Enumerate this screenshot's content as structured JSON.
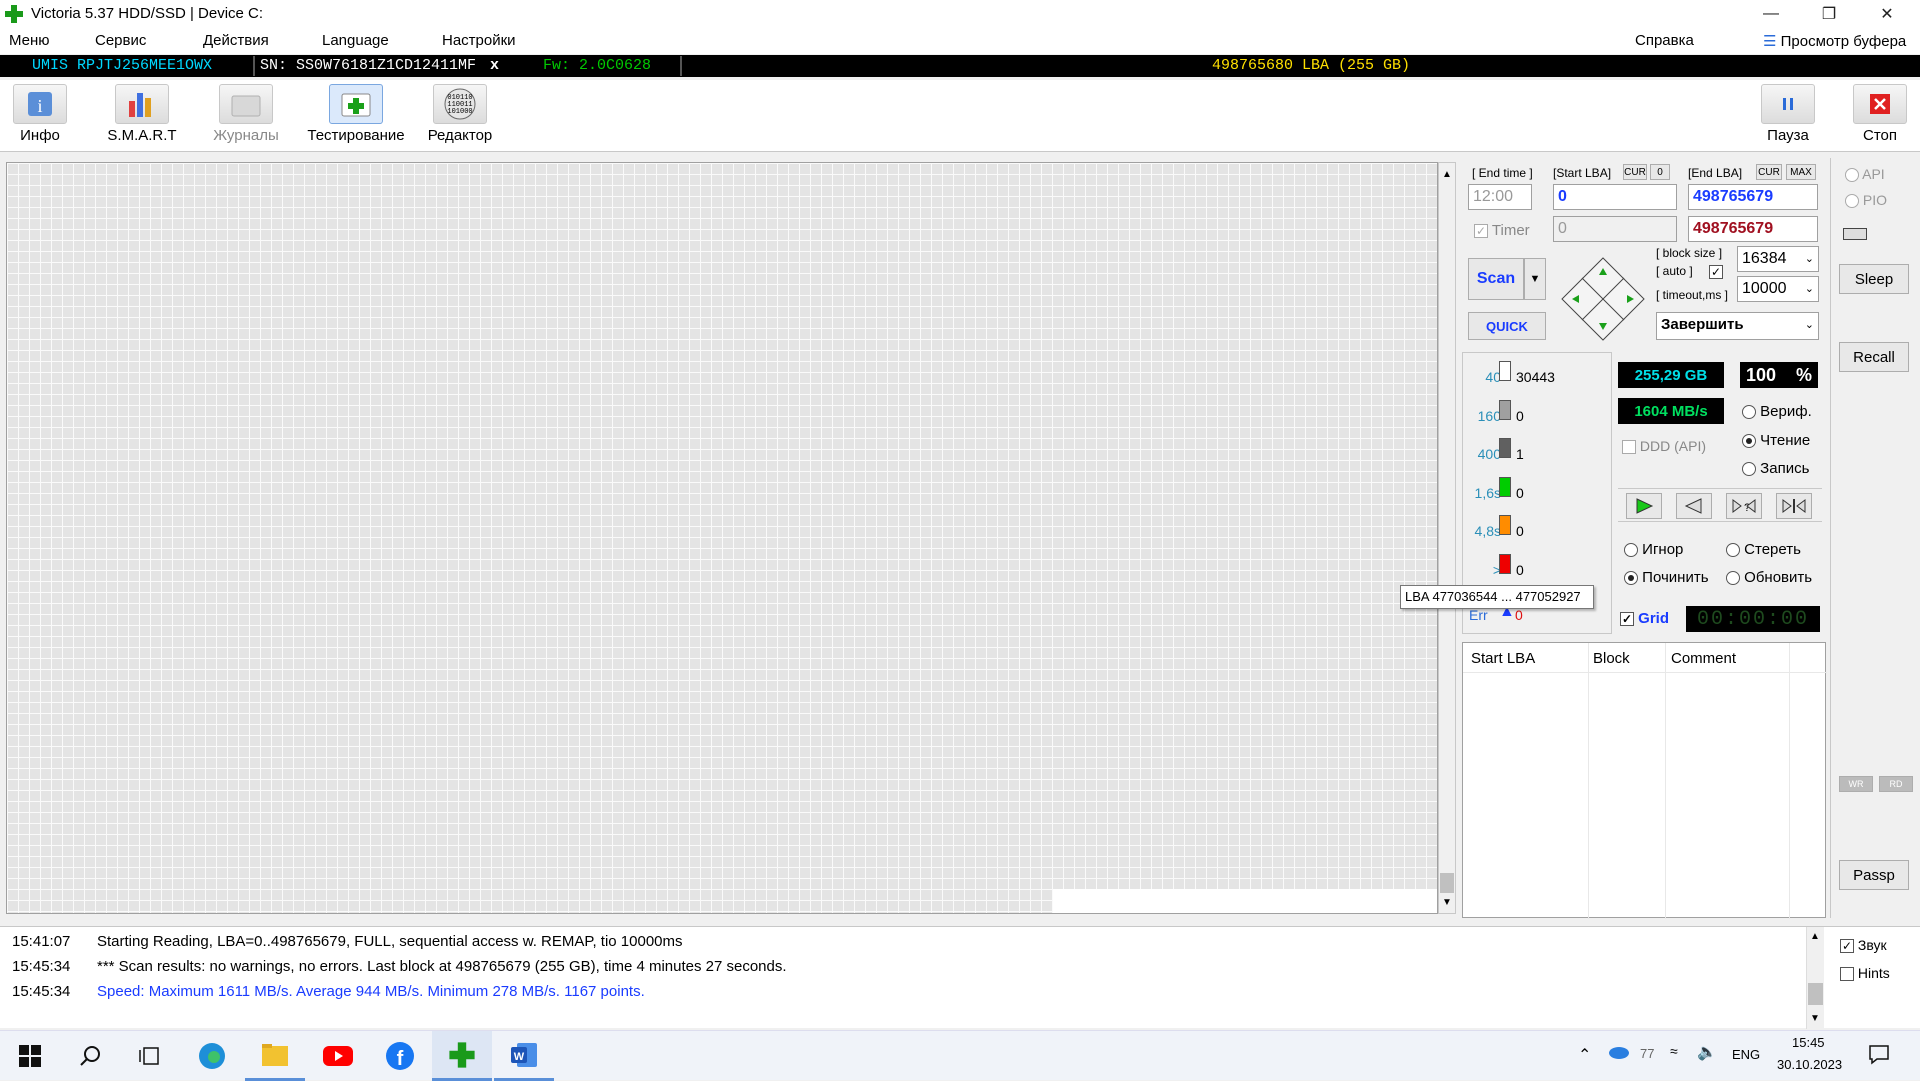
{
  "window": {
    "title": "Victoria 5.37 HDD/SSD | Device C:"
  },
  "menu": {
    "items": [
      "Меню",
      "Сервис",
      "Действия",
      "Language",
      "Настройки"
    ],
    "help": "Справка",
    "view_buffer": "Просмотр буфера"
  },
  "device": {
    "model": "UMIS RPJTJ256MEE1OWX",
    "serial": "SN: SS0W76181Z1CD12411MF",
    "close": "x",
    "firmware": "Fw: 2.0C0628",
    "capacity": "498765680 LBA (255 GB)"
  },
  "toolbar": {
    "tools": [
      "Инфо",
      "S.M.A.R.T",
      "Журналы",
      "Тестирование",
      "Редактор"
    ],
    "pause": "Пауза",
    "stop": "Стоп"
  },
  "scan": {
    "end_time_label": "[ End time ]",
    "end_time": "12:00",
    "timer_label": "Timer",
    "start_lba_label": "[Start LBA]",
    "cur": "CUR",
    "zero": "0",
    "start_lba": "0",
    "start_lba2": "0",
    "end_lba_label": "[End LBA]",
    "max": "MAX",
    "end_lba": "498765679",
    "end_lba2": "498765679",
    "scan_btn": "Scan",
    "quick_btn": "QUICK",
    "block_size_label": "[ block size ]",
    "auto_label": "[ auto ]",
    "block_size": "16384",
    "timeout_label": "[ timeout,ms ]",
    "timeout": "10000",
    "finish": "Завершить"
  },
  "stats": {
    "rows": [
      {
        "label": "40",
        "count": "30443",
        "color": "#ffffff"
      },
      {
        "label": "160",
        "count": "0",
        "color": "#a0a0a0"
      },
      {
        "label": "400",
        "count": "1",
        "color": "#606060"
      },
      {
        "label": "1,6s",
        "count": "0",
        "color": "#00cc00"
      },
      {
        "label": "4,8s",
        "count": "0",
        "color": "#ff8c00"
      },
      {
        "label": ">",
        "count": "0",
        "color": "#ee0000"
      }
    ],
    "err_label": "Err",
    "err_count": "0",
    "tooltip": "LBA  477036544 ... 477052927"
  },
  "readouts": {
    "size": "255,29 GB",
    "percent": "100",
    "percent_sign": "%",
    "speed": "1604 MB/s",
    "ddd": "DDD (API)"
  },
  "modes": {
    "verify": "Вериф.",
    "read": "Чтение",
    "write": "Запись"
  },
  "actions": {
    "ignore": "Игнор",
    "erase": "Стереть",
    "repair": "Починить",
    "refresh": "Обновить"
  },
  "grid_label": "Grid",
  "clock": "00:00:00",
  "table": {
    "headers": [
      "Start LBA",
      "Block",
      "Comment"
    ]
  },
  "side": {
    "api": "API",
    "pio": "PIO",
    "sleep": "Sleep",
    "recall": "Recall",
    "wr": "WR",
    "rd": "RD",
    "passp": "Passp",
    "sound": "Звук",
    "hints": "Hints"
  },
  "log": [
    {
      "time": "15:41:07",
      "text": "Starting Reading, LBA=0..498765679, FULL, sequential access w. REMAP, tio 10000ms",
      "color": "#000000"
    },
    {
      "time": "15:45:34",
      "text": "*** Scan results: no warnings, no errors. Last block at 498765679 (255 GB), time 4 minutes 27 seconds.",
      "color": "#000000"
    },
    {
      "time": "15:45:34",
      "text": "Speed: Maximum 1611 MB/s. Average 944 MB/s. Minimum 278 MB/s. 1167 points.",
      "color": "#1a3cff"
    }
  ],
  "taskbar": {
    "temp": "77",
    "lang": "ENG",
    "time": "15:45",
    "date": "30.10.2023"
  }
}
